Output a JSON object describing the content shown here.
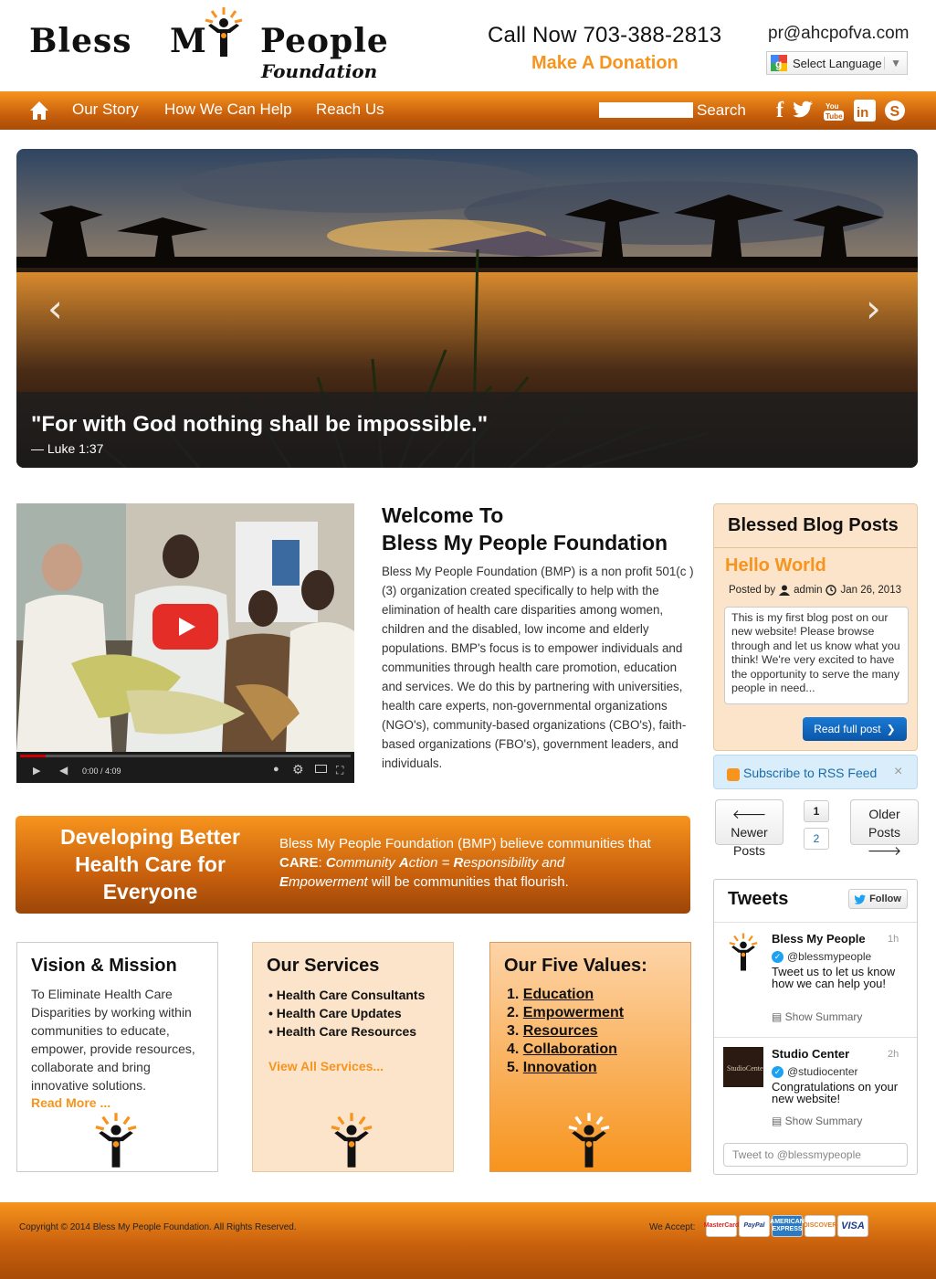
{
  "header": {
    "logo": {
      "word1": "Bless",
      "word2": "M",
      "word3": "People",
      "tagline": "Foundation"
    },
    "call": "Call Now 703-388-2813",
    "donate": "Make A Donation",
    "email": "pr@ahcpofva.com",
    "language": "Select Language"
  },
  "nav": {
    "items": [
      "Our Story",
      "How We Can Help",
      "Reach Us"
    ],
    "search_label": "Search",
    "social": [
      "facebook-icon",
      "twitter-icon",
      "youtube-icon",
      "linkedin-icon",
      "skype-icon"
    ]
  },
  "hero": {
    "quote": "\"For with God nothing shall be impossible.\"",
    "cite": "— Luke 1:37"
  },
  "video": {
    "time": "0:00 / 4:09"
  },
  "welcome": {
    "title_line1": "Welcome To",
    "title_line2": "Bless My People Foundation",
    "body": "Bless My People Foundation (BMP) is a non profit 501(c ) (3) organization created specifically to help with the elimination of health care disparities among women, children and the disabled, low income and elderly populations. BMP's focus is to empower individuals and communities through health care promotion, education and services. We do this by partnering with universities, health care experts, non-governmental organizations (NGO's), community-based organizations (CBO's), faith-based organizations (FBO's), government leaders, and individuals."
  },
  "banner": {
    "title": "Developing Better Health Care for Everyone",
    "text_1": "Bless My People Foundation (BMP) believe communities that ",
    "care": "CARE",
    "text_2": ": ",
    "c": "C",
    "community": "ommunity ",
    "a": "A",
    "action": "ction = ",
    "r": "R",
    "responsibility": "esponsibility and",
    "e": "E",
    "empowerment": "mpowerment",
    "text_3": " will be communities that flourish."
  },
  "vision": {
    "title": "Vision & Mission",
    "text": "To Eliminate Health Care Disparities by working within communities to educate, empower, provide resources, collaborate and bring innovative solutions.",
    "more": "Read More ..."
  },
  "services": {
    "title": "Our Services",
    "items": [
      "• Health Care Consultants",
      "• Health Care Updates",
      "• Health Care Resources"
    ],
    "more": "View All Services..."
  },
  "values": {
    "title": "Our Five Values:",
    "items": [
      {
        "num": "1.",
        "label": "Education"
      },
      {
        "num": "2.",
        "label": "Empowerment"
      },
      {
        "num": "3.",
        "label": "Resources"
      },
      {
        "num": "4.",
        "label": "Collaboration"
      },
      {
        "num": "5.",
        "label": "Innovation"
      }
    ]
  },
  "blog": {
    "title": "Blessed Blog Posts",
    "post_title": "Hello World",
    "posted_by": "Posted by",
    "author": "admin",
    "date": "Jan 26, 2013",
    "excerpt": "This is my first blog post on our new website! Please browse through and let us know what you think! We're very excited to have the opportunity to serve the many people in need...",
    "read_more": "Read full post"
  },
  "rss": {
    "label": "Subscribe to RSS Feed",
    "close": "×"
  },
  "pager": {
    "newer": "Newer Posts",
    "older": "Older Posts",
    "pages": [
      "1",
      "2"
    ]
  },
  "tweets": {
    "title": "Tweets",
    "follow": "Follow",
    "items": [
      {
        "name": "Bless My People",
        "time": "1h",
        "handle": "@blessmypeople",
        "msg": "Tweet us to let us know how we can help you!",
        "summary": "Show Summary"
      },
      {
        "name": "Studio Center",
        "time": "2h",
        "handle": "@studiocenter",
        "msg": "Congratulations on your new website!",
        "summary": "Show Summary"
      }
    ],
    "input_placeholder": "Tweet to @blessmypeople"
  },
  "footer": {
    "copyright": "Copyright © 2014 Bless My People Foundation. All Rights Reserved.",
    "accept": "We Accept:",
    "cards": [
      "MasterCard",
      "PayPal",
      "AMERICAN EXPRESS",
      "DISCOVER",
      "VISA"
    ]
  },
  "colors": {
    "brand_orange": "#f7941d",
    "dark_orange": "#a84c07",
    "link_blue": "#0a56a8"
  }
}
